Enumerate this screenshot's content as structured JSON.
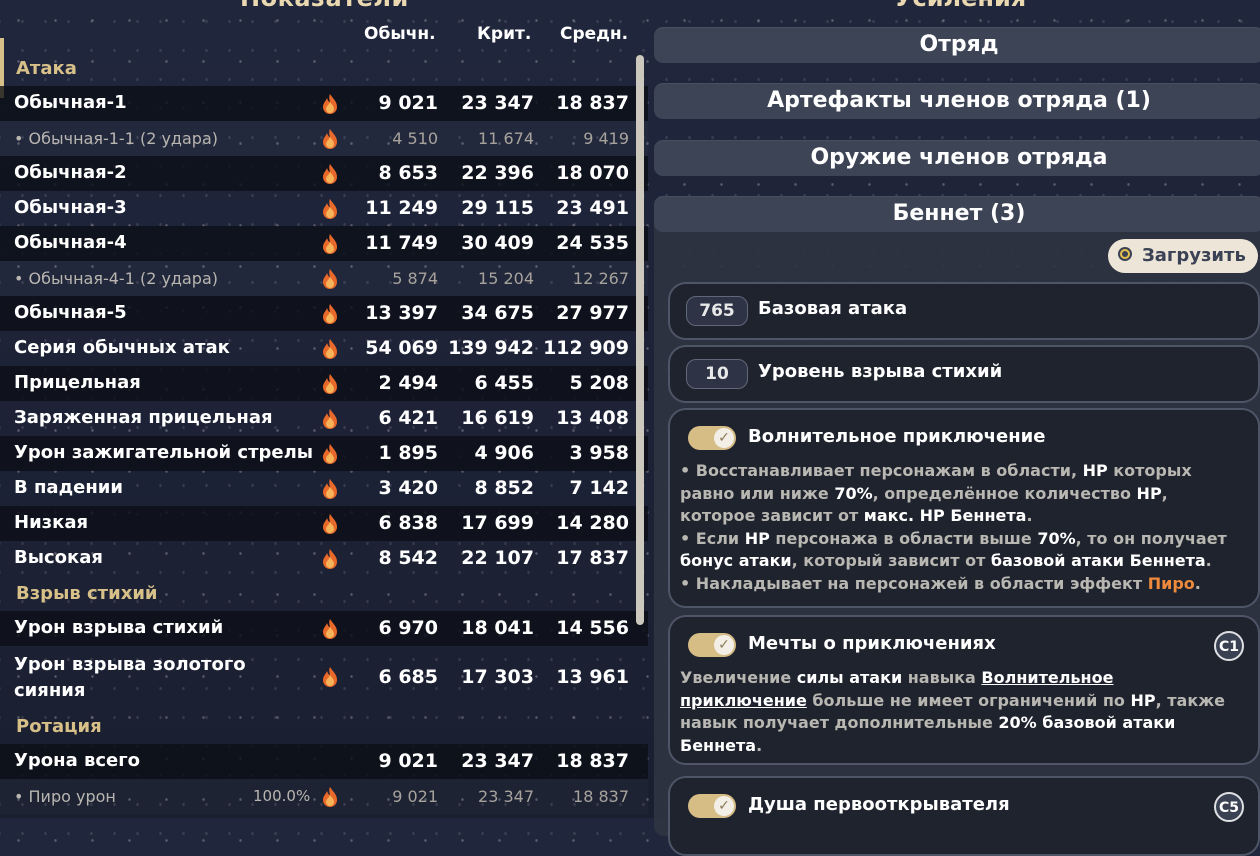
{
  "left": {
    "title": "Показатели",
    "columns": [
      "Обычн.",
      "Крит.",
      "Средн."
    ],
    "sections": {
      "attack": "Атака",
      "burst": "Взрыв стихий",
      "rotation": "Ротация"
    },
    "rows": [
      {
        "name": "Обычная-1",
        "v": [
          "9 021",
          "23 347",
          "18 837"
        ]
      },
      {
        "name": "• Обычная-1-1 (2 удара)",
        "v": [
          "4 510",
          "11 674",
          "9 419"
        ]
      },
      {
        "name": "Обычная-2",
        "v": [
          "8 653",
          "22 396",
          "18 070"
        ]
      },
      {
        "name": "Обычная-3",
        "v": [
          "11 249",
          "29 115",
          "23 491"
        ]
      },
      {
        "name": "Обычная-4",
        "v": [
          "11 749",
          "30 409",
          "24 535"
        ]
      },
      {
        "name": "• Обычная-4-1 (2 удара)",
        "v": [
          "5 874",
          "15 204",
          "12 267"
        ]
      },
      {
        "name": "Обычная-5",
        "v": [
          "13 397",
          "34 675",
          "27 977"
        ]
      },
      {
        "name": "Серия обычных атак",
        "v": [
          "54 069",
          "139 942",
          "112 909"
        ]
      },
      {
        "name": "Прицельная",
        "v": [
          "2 494",
          "6 455",
          "5 208"
        ]
      },
      {
        "name": "Заряженная прицельная",
        "v": [
          "6 421",
          "16 619",
          "13 408"
        ]
      },
      {
        "name": "Урон зажигательной стрелы",
        "v": [
          "1 895",
          "4 906",
          "3 958"
        ]
      },
      {
        "name": "В падении",
        "v": [
          "3 420",
          "8 852",
          "7 142"
        ]
      },
      {
        "name": "Низкая",
        "v": [
          "6 838",
          "17 699",
          "14 280"
        ]
      },
      {
        "name": "Высокая",
        "v": [
          "8 542",
          "22 107",
          "17 837"
        ]
      },
      {
        "name": "Урон взрыва стихий",
        "v": [
          "6 970",
          "18 041",
          "14 556"
        ]
      },
      {
        "name": "Урон взрыва золотого сияния",
        "v": [
          "6 685",
          "17 303",
          "13 961"
        ]
      },
      {
        "name": "Урона всего",
        "v": [
          "9 021",
          "23 347",
          "18 837"
        ]
      },
      {
        "name": "• Пиро урон",
        "pct": "100.0%",
        "v": [
          "9 021",
          "23 347",
          "18 837"
        ]
      }
    ]
  },
  "right": {
    "title": "Усиления",
    "bands": [
      "Отряд",
      "Артефакты членов отряда (1)",
      "Оружие членов отряда",
      "Беннет (3)"
    ],
    "load_button": "Загрузить",
    "base_attack": {
      "value": "765",
      "label": "Базовая атака"
    },
    "burst_level": {
      "value": "10",
      "label": "Уровень взрыва стихий"
    },
    "card1": {
      "title": "Волнительное приключение",
      "l1a": "• Восстанавливает персонажам в области, ",
      "l1b": "HP",
      "l1c": " которых",
      "l2a": "равно или ниже ",
      "l2b": "70%",
      "l2c": ", определённое количество ",
      "l2d": "HP",
      "l3a": "которое зависит от ",
      "l3b": "макс. HP Беннета",
      "l3c": ".",
      "l4a": "• Если ",
      "l4b": "HP",
      "l4c": " персонажа в области выше ",
      "l4d": "70%",
      "l4e": ", то он получает",
      "l5a": "бонус атаки",
      "l5b": ", который зависит от ",
      "l5c": "базовой атаки Беннета",
      "l5d": ".",
      "l6a": "• Накладывает на персонажей в области эффект ",
      "l6b": "Пиро",
      "l6c": "."
    },
    "card2": {
      "title": "Мечты о приключениях",
      "badge": "C1",
      "a": "Увеличение ",
      "b": "силы атаки",
      "c": " навыка ",
      "d": "Волнительное",
      "e": "приключение",
      "f": " больше не имеет ограничений по ",
      "g": "HP",
      "h": ", также",
      "i": "навык получает дополнительные ",
      "j": "20% базовой атаки",
      "k": "Беннета",
      "l": "."
    },
    "card3": {
      "title": "Душа первооткрывателя",
      "badge": "C5"
    }
  }
}
